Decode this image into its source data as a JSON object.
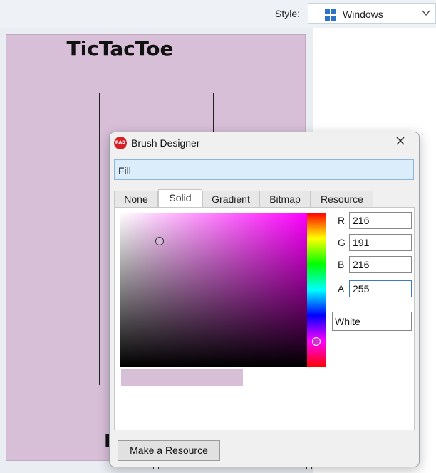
{
  "toolbar": {
    "style_label": "Style:",
    "style_value": "Windows"
  },
  "board": {
    "title": "TicTacToe",
    "bottom_text_partial": "I",
    "fill_color": "#d8bfd8"
  },
  "dialog": {
    "title": "Brush Designer",
    "icon_text": "RAD",
    "property_name": "Fill",
    "tabs": [
      {
        "label": "None"
      },
      {
        "label": "Solid"
      },
      {
        "label": "Gradient"
      },
      {
        "label": "Bitmap"
      },
      {
        "label": "Resource"
      }
    ],
    "active_tab": "Solid",
    "channels": {
      "r": {
        "label": "R",
        "value": "216"
      },
      "g": {
        "label": "G",
        "value": "191"
      },
      "b": {
        "label": "B",
        "value": "216"
      },
      "a": {
        "label": "A",
        "value": "255"
      }
    },
    "color_name": "White",
    "make_resource_label": "Make a Resource"
  }
}
